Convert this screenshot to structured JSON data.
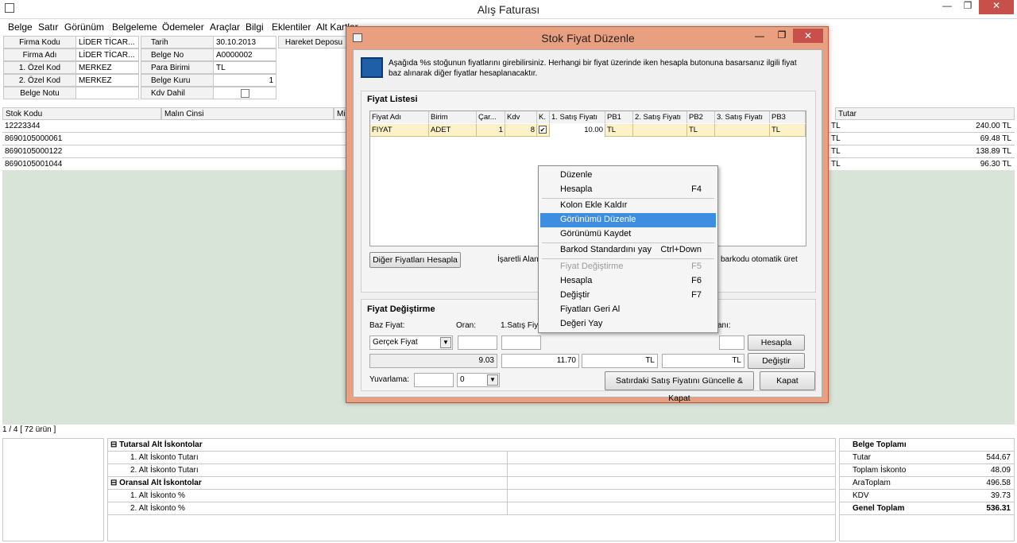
{
  "window": {
    "title": "Alış Faturası",
    "minimize": "—",
    "maximize": "❐",
    "close": "✕"
  },
  "menu": [
    "Belge",
    "Satır",
    "Görünüm",
    "Belgeleme",
    "Ödemeler",
    "Araçlar",
    "Bilgi",
    "Eklentiler",
    "Alt Kartlar"
  ],
  "header": {
    "firma_kodu_label": "Firma Kodu",
    "firma_kodu": "LİDER TİCAR...",
    "firma_adi_label": "Firma Adı",
    "firma_adi": "LİDER TİCAR...",
    "ozel_kod1_label": "1. Özel Kod",
    "ozel_kod1": "MERKEZ",
    "ozel_kod2_label": "2. Özel Kod",
    "ozel_kod2": "MERKEZ",
    "belge_notu_label": "Belge Notu",
    "belge_notu": "",
    "tarih_label": "Tarih",
    "tarih": "30.10.2013",
    "belge_no_label": "Belge No",
    "belge_no": "A0000002",
    "para_birimi_label": "Para Birimi",
    "para_birimi": "TL",
    "belge_kuru_label": "Belge Kuru",
    "belge_kuru": "1",
    "kdv_dahil_label": "Kdv Dahil",
    "hareket_deposu_label": "Hareket Deposu"
  },
  "grid": {
    "headers": {
      "stok_kodu": "Stok Kodu",
      "malin_cinsi": "Malın Cinsi",
      "mik": "Mik",
      "tutar": "Tutar"
    },
    "rows": [
      {
        "stok_kodu": "12223344",
        "tl": "TL",
        "tutar": "240.00 TL"
      },
      {
        "stok_kodu": "8690105000061",
        "tl": "TL",
        "tutar": "69.48 TL"
      },
      {
        "stok_kodu": "8690105000122",
        "tl": "TL",
        "tutar": "138.89 TL"
      },
      {
        "stok_kodu": "8690105001044",
        "tl": "TL",
        "tutar": "96.30 TL"
      }
    ],
    "status": "1 / 4  [ 72 ürün ]"
  },
  "dialog": {
    "title": "Stok Fiyat Düzenle",
    "info": "Aşağıda %s stoğunun fiyatlarını girebilirsiniz. Herhangi bir fiyat üzerinde iken hesapla butonuna basarsanız ilgili fiyat baz alınarak diğer fiyatlar hesaplanacaktır.",
    "fiyat_listesi": "Fiyat Listesi",
    "columns": [
      "Fiyat Adı",
      "Birim",
      "Çar...",
      "Kdv",
      "K.",
      "1. Satış Fiyatı",
      "PB1",
      "2. Satış Fiyatı",
      "PB2",
      "3. Satış Fiyatı",
      "PB3"
    ],
    "row": {
      "fiyat_adi": "FIYAT",
      "birim": "ADET",
      "carpan": "1",
      "kdv": "8",
      "satis1": "10.00",
      "pb1": "TL",
      "satis2": "",
      "pb2": "TL",
      "satis3": "",
      "pb3": "TL"
    },
    "diger_fiyatlari_hesapla": "Diğer Fiyatları Hesapla",
    "isaretli_alan": "İşaretli Alan",
    "barkodu_uret": "barkodu otomatik üret",
    "fiyat_degistirme": "Fiyat Değiştirme",
    "baz_fiyat_label": "Baz Fiyat:",
    "oran_label": "Oran:",
    "satis_label": "1.Satış Fiyatı",
    "ani_label": "anı:",
    "baz_fiyat": "Gerçek Fiyat",
    "baz_value": "9.03",
    "partial_value": "11.70",
    "tl1": "TL",
    "tl2": "TL",
    "hesapla": "Hesapla",
    "degistir": "Değiştir",
    "yuvarlama_label": "Yuvarlama:",
    "yuvarlama_value": "0",
    "guncelle_kapat": "Satırdaki Satış Fiyatını Güncelle & Kapat",
    "kapat": "Kapat"
  },
  "context_menu": {
    "items": [
      {
        "label": "Düzenle",
        "key": ""
      },
      {
        "label": "Hesapla",
        "key": "F4"
      },
      {
        "label": "Kolon Ekle Kaldır",
        "key": ""
      },
      {
        "label": "Görünümü Düzenle",
        "key": ""
      },
      {
        "label": "Görünümü Kaydet",
        "key": ""
      },
      {
        "label": "Barkod Standardını yay",
        "key": "Ctrl+Down"
      },
      {
        "label": "Fiyat Değiştirme",
        "key": "F5"
      },
      {
        "label": "Hesapla",
        "key": "F6"
      },
      {
        "label": "Değiştir",
        "key": "F7"
      },
      {
        "label": "Fiyatları Geri Al",
        "key": ""
      },
      {
        "label": "Değeri Yay",
        "key": ""
      }
    ]
  },
  "bottom": {
    "tutarsal": "Tutarsal Alt İskontolar",
    "t1": "1. Alt İskonto Tutarı",
    "t2": "2. Alt İskonto Tutarı",
    "oransal": "Oransal Alt İskontolar",
    "o1": "1. Alt İskonto %",
    "o2": "2. Alt İskonto %",
    "belge_toplami": "Belge Toplamı",
    "tutar_label": "Tutar",
    "tutar": "544.67",
    "iskonto_label": "Toplam İskonto",
    "iskonto": "48.09",
    "ara_label": "AraToplam",
    "ara": "496.58",
    "kdv_label": "KDV",
    "kdv": "39.73",
    "genel_label": "Genel Toplam",
    "genel": "536.31"
  }
}
